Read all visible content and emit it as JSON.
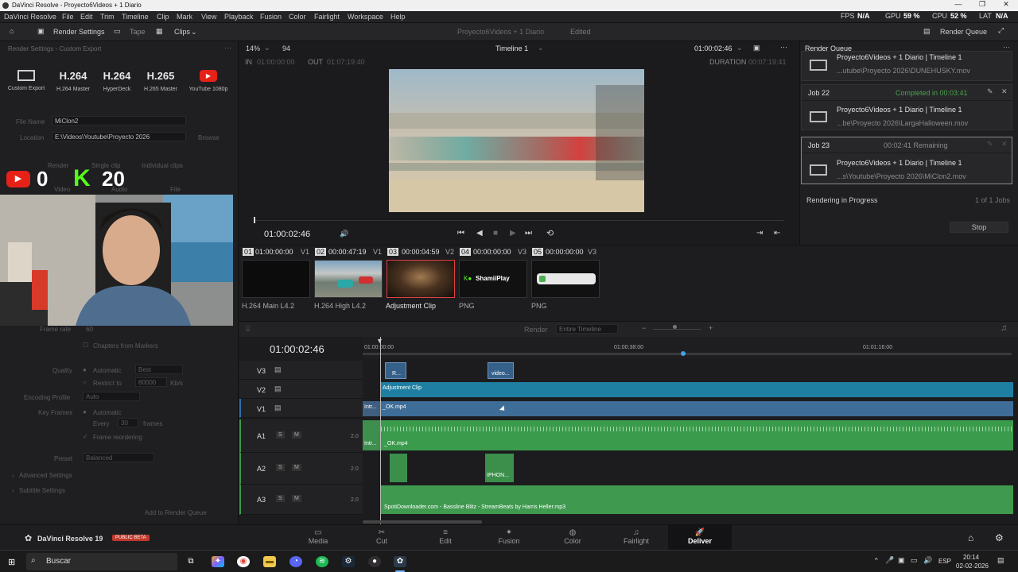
{
  "window": {
    "title": "DaVinci Resolve - Proyecto6Videos + 1 Diario",
    "min": "—",
    "max": "❐",
    "close": "✕"
  },
  "menu": {
    "items": [
      "DaVinci Resolve",
      "File",
      "Edit",
      "Trim",
      "Timeline",
      "Clip",
      "Mark",
      "View",
      "Playback",
      "Fusion",
      "Color",
      "Fairlight",
      "Workspace",
      "Help"
    ],
    "fps_label": "FPS",
    "fps_value": "N/A",
    "gpu_label": "GPU",
    "gpu_value": "59 %",
    "cpu_label": "CPU",
    "cpu_value": "52 %",
    "lat_label": "LAT",
    "lat_value": "N/A"
  },
  "toolbar": {
    "render_settings": "Render Settings",
    "tape": "Tape",
    "clips": "Clips",
    "project": "Proyecto6Videos + 1 Diario",
    "status": "Edited",
    "render_queue": "Render Queue"
  },
  "left": {
    "header": "Render Settings - Custom Export",
    "presets": [
      {
        "big": "",
        "label": "Custom Export"
      },
      {
        "big": "H.264",
        "label": "H.264 Master"
      },
      {
        "big": "H.264",
        "label": "HyperDeck"
      },
      {
        "big": "H.265",
        "label": "H.265 Master"
      },
      {
        "big": "",
        "label": "YouTube 1080p"
      }
    ],
    "file_name_label": "File Name",
    "file_name_value": "MiClon2",
    "location_label": "Location",
    "location_value": "E:\\Videos\\Youtube\\Proyecto 2026",
    "browse": "Browse",
    "render_label": "Render",
    "single_clip": "Single clip",
    "individual_clips": "Individual clips",
    "tabs": [
      "Video",
      "Audio",
      "File"
    ],
    "frame_rate_label": "Frame rate",
    "frame_rate_value": "60",
    "chapters": "Chapters from Markers",
    "quality_label": "Quality",
    "quality_auto": "Automatic",
    "quality_best": "Best",
    "restrict_label": "Restrict to",
    "restrict_value": "80000",
    "restrict_unit": "Kb/s",
    "enc_profile_label": "Encoding Profile",
    "enc_profile_value": "Auto",
    "keyframes_label": "Key Frames",
    "keyframes_auto": "Automatic",
    "every_label": "Every",
    "every_value": "30",
    "frames_unit": "frames",
    "frame_reordering": "Frame reordering",
    "preset_label": "Preset",
    "preset_value": "Balanced",
    "advanced": "Advanced Settings",
    "subtitle": "Subtitle Settings",
    "add_queue": "Add to Render Queue"
  },
  "overlay": {
    "youtube_count": "0",
    "kick_count": "20"
  },
  "viewer": {
    "zoom": "14%",
    "frame_count": "94",
    "timeline_name": "Timeline 1",
    "timecode_top": "01:00:02:46",
    "in_label": "IN",
    "in_value": "01:00:00:00",
    "out_label": "OUT",
    "out_value": "01:07:19:40",
    "duration_label": "DURATION",
    "duration_value": "00:07:19:41",
    "timecode": "01:00:02:46"
  },
  "render_queue": {
    "title": "Render Queue",
    "jobs": [
      {
        "header": "",
        "status": "",
        "title": "Proyecto6Videos + 1 Diario | Timeline 1",
        "path": "...utube\\Proyecto 2026\\DUNEHUSKY.mov"
      },
      {
        "header": "Job 22",
        "status": "Completed in 00:03:41",
        "title": "Proyecto6Videos + 1 Diario | Timeline 1",
        "path": "...be\\Proyecto 2026\\LargaHalloween.mov"
      },
      {
        "header": "Job 23",
        "status": "00:02:41 Remaining",
        "title": "Proyecto6Videos + 1 Diario | Timeline 1",
        "path": "...s\\Youtube\\Proyecto 2026\\MiClon2.mov"
      }
    ],
    "rendering": "Rendering in Progress",
    "jobs_count": "1 of 1 Jobs",
    "stop": "Stop"
  },
  "clips": [
    {
      "num": "01",
      "tc": "01:00:00:00",
      "track": "V1",
      "label": "H.264 Main L4.2"
    },
    {
      "num": "02",
      "tc": "00:00:47:19",
      "track": "V1",
      "label": "H.264 High L4.2"
    },
    {
      "num": "03",
      "tc": "00:00:04:59",
      "track": "V2",
      "label": "Adjustment Clip"
    },
    {
      "num": "04",
      "tc": "00:00:00:00",
      "track": "V3",
      "label": "PNG"
    },
    {
      "num": "05",
      "tc": "00:00:00:00",
      "track": "V3",
      "label": "PNG"
    }
  ],
  "thumb_text": {
    "shamii": "ShamiiPlay"
  },
  "tlbar": {
    "render_label": "Render",
    "render_value": "Entire Timeline"
  },
  "timeline": {
    "timecode": "01:00:02:46",
    "ruler": [
      "01:00:00:00",
      "01:00:38:00",
      "01:01:16:00"
    ],
    "tracks": [
      {
        "name": "V3"
      },
      {
        "name": "V2"
      },
      {
        "name": "V1"
      },
      {
        "name": "A1",
        "vol": "2.0"
      },
      {
        "name": "A2",
        "vol": "2.0"
      },
      {
        "name": "A3",
        "vol": "2.0"
      }
    ],
    "s_btn": "S",
    "m_btn": "M",
    "clip_v3a": "R...",
    "clip_v3b": "video...",
    "clip_v2": "Adjustment Clip",
    "clip_v1a": "Intr...",
    "clip_v1b": "_OK.mp4",
    "clip_a1a": "Intr...",
    "clip_a1b": "_OK.mp4",
    "clip_a2": "IPHON...",
    "clip_a3": "SpotiDownloader.com - Bassline Blitz - StreamBeats by Harris Heller.mp3"
  },
  "pages": [
    {
      "label": "Media",
      "icon": "▭"
    },
    {
      "label": "Cut",
      "icon": "✂"
    },
    {
      "label": "Edit",
      "icon": "≡"
    },
    {
      "label": "Fusion",
      "icon": "✦"
    },
    {
      "label": "Color",
      "icon": "◍"
    },
    {
      "label": "Fairlight",
      "icon": "♫"
    },
    {
      "label": "Deliver",
      "icon": "🚀"
    }
  ],
  "branding": {
    "app": "DaVinci Resolve 19",
    "beta": "PUBLIC BETA"
  },
  "taskbar": {
    "search": "Buscar",
    "lang": "ESP",
    "time": "20:14",
    "date": "02-02-2026"
  }
}
